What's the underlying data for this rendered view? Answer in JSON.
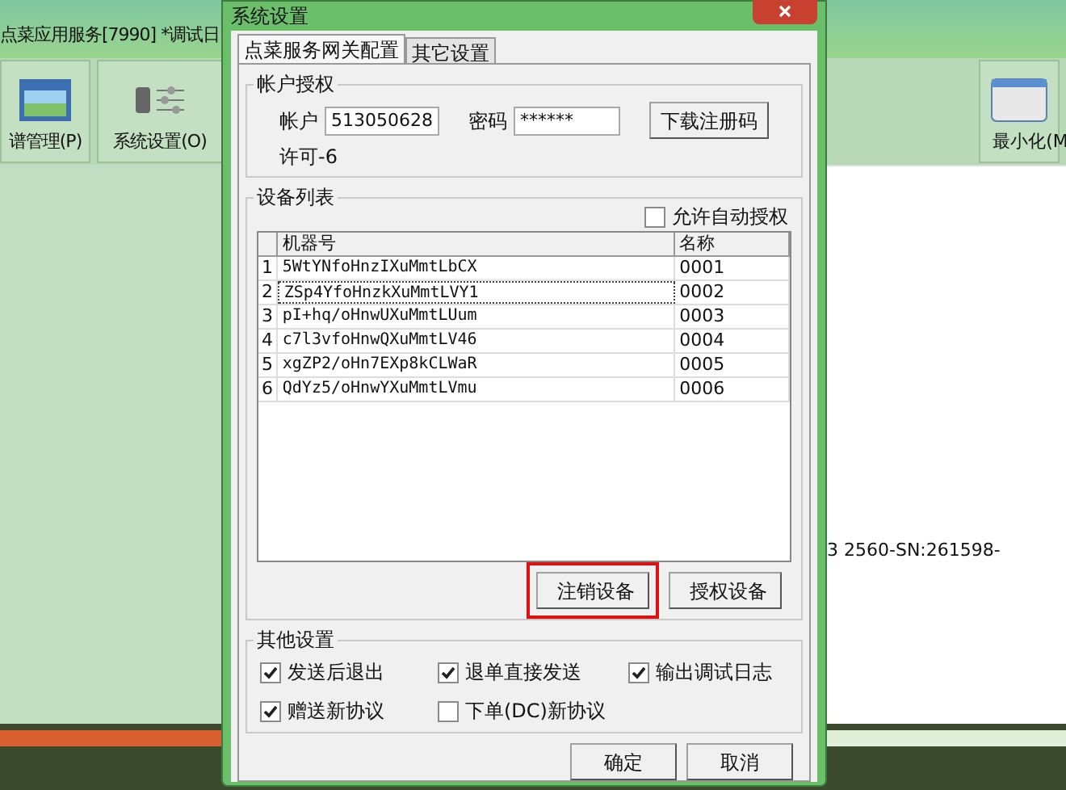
{
  "app": {
    "title": "点菜应用服务[7990]  *调试日",
    "toolbar": [
      {
        "label": "谱管理(P)",
        "kind": "photo"
      },
      {
        "label": "系统设置(O)",
        "kind": "settings"
      }
    ],
    "minimize": {
      "label": "最小化(M"
    },
    "log_text": "3 2560-SN:261598-",
    "progress": {
      "level": 0.45
    }
  },
  "dialog": {
    "title": "系统设置",
    "tabs": [
      {
        "label": "点菜服务网关配置",
        "selected": true
      },
      {
        "label": "其它设置",
        "selected": false
      }
    ],
    "account": {
      "title": "帐户授权",
      "account_label": "帐户",
      "account_value": "513050628",
      "password_label": "密码",
      "password_value": "******",
      "download_button": "下载注册码",
      "license": "许可-6"
    },
    "devices": {
      "title": "设备列表",
      "auto_auth": {
        "label": "允许自动授权",
        "checked": false
      },
      "columns": [
        "机器号",
        "名称"
      ],
      "rows": [
        {
          "index": "1",
          "machine": "5WtYNfoHnzIXuMmtLbCX",
          "name": "0001",
          "focused": false
        },
        {
          "index": "2",
          "machine": "ZSp4YfoHnzkXuMmtLVY1",
          "name": "0002",
          "focused": true
        },
        {
          "index": "3",
          "machine": "pI+hq/oHnwUXuMmtLUum",
          "name": "0003",
          "focused": false
        },
        {
          "index": "4",
          "machine": "c7l3vfoHnwQXuMmtLV46",
          "name": "0004",
          "focused": false
        },
        {
          "index": "5",
          "machine": "xgZP2/oHn7EXp8kCLWaR",
          "name": "0005",
          "focused": false
        },
        {
          "index": "6",
          "machine": "QdYz5/oHnwYXuMmtLVmu",
          "name": "0006",
          "focused": false
        }
      ],
      "buttons": [
        {
          "label": "注销设备",
          "highlighted": true
        },
        {
          "label": "授权设备",
          "highlighted": false
        }
      ]
    },
    "other": {
      "title": "其他设置",
      "options": [
        {
          "label": "发送后退出",
          "checked": true
        },
        {
          "label": "退单直接发送",
          "checked": true
        },
        {
          "label": "输出调试日志",
          "checked": true
        },
        {
          "label": "赠送新协议",
          "checked": true
        },
        {
          "label": "下单(DC)新协议",
          "checked": false
        }
      ]
    },
    "buttons": [
      "确定",
      "取消"
    ]
  }
}
